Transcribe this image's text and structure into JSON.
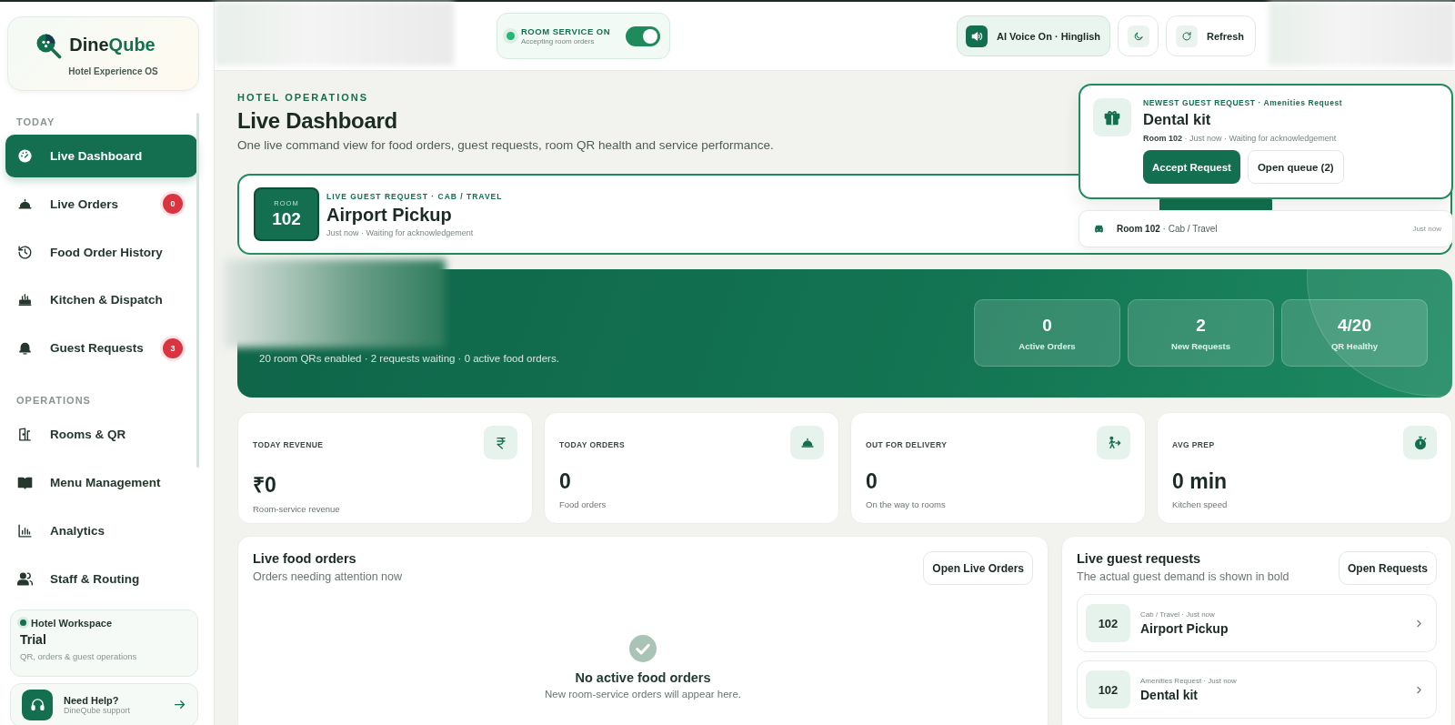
{
  "sidebar": {
    "brand": {
      "name_parts": [
        "Dine",
        "Qube"
      ],
      "tagline": "Hotel Experience OS"
    },
    "sections": [
      {
        "heading": "TODAY",
        "items": [
          {
            "label": "Live Dashboard",
            "selected": true
          },
          {
            "label": "Live Orders",
            "badge": "0",
            "selected": false
          },
          {
            "label": "Food Order History",
            "selected": false
          },
          {
            "label": "Kitchen & Dispatch",
            "selected": false
          },
          {
            "label": "Guest Requests",
            "badge": "3",
            "selected": false
          }
        ]
      },
      {
        "heading": "OPERATIONS",
        "items": [
          {
            "label": "Rooms & QR",
            "selected": false
          },
          {
            "label": "Menu Management",
            "selected": false
          },
          {
            "label": "Analytics",
            "selected": false
          },
          {
            "label": "Staff & Routing",
            "selected": false
          }
        ]
      }
    ],
    "workspace": {
      "label": "Hotel Workspace",
      "plan": "Trial",
      "description": "QR, orders & guest operations"
    },
    "help": {
      "title": "Need Help?",
      "subtitle": "DineQube support"
    }
  },
  "topbar": {
    "room_service": {
      "title": "ROOM SERVICE ON",
      "subtitle": "Accepting room orders",
      "on": true
    },
    "voice": {
      "label": "AI Voice On · Hinglish"
    },
    "refresh": {
      "label": "Refresh"
    }
  },
  "header": {
    "eyebrow": "HOTEL OPERATIONS",
    "title": "Live Dashboard",
    "subtitle": "One live command view for food orders, guest requests, room QR health and service performance."
  },
  "live_request": {
    "room_label": "ROOM",
    "room": "102",
    "eyebrow": "LIVE GUEST REQUEST · CAB / TRAVEL",
    "title": "Airport Pickup",
    "meta": "Just now · Waiting for acknowledgement"
  },
  "toast": {
    "eyebrow": "NEWEST GUEST REQUEST · Amenities Request",
    "title": "Dental kit",
    "meta": "**Room 102** · Just now · Waiting for acknowledgement",
    "buttons": [
      "Accept Request",
      "Open queue (2)"
    ]
  },
  "mini_toast": {
    "text": "**Room 102** · Cab / Travel",
    "time": "Just now"
  },
  "hero": {
    "summary": "20 room QRs enabled · 2 requests waiting · 0 active food orders.",
    "stats": [
      {
        "value": "0",
        "label": "Active Orders"
      },
      {
        "value": "2",
        "label": "New Requests"
      },
      {
        "value": "4/20",
        "label": "QR Healthy"
      }
    ]
  },
  "metrics": [
    {
      "label": "TODAY REVENUE",
      "value": "₹0",
      "sub": "Room-service revenue"
    },
    {
      "label": "TODAY ORDERS",
      "value": "0",
      "sub": "Food orders"
    },
    {
      "label": "OUT FOR DELIVERY",
      "value": "0",
      "sub": "On the way to rooms"
    },
    {
      "label": "AVG PREP",
      "value": "0 min",
      "sub": "Kitchen speed"
    }
  ],
  "food_orders": {
    "title": "Live food orders",
    "subtitle": "Orders needing attention now",
    "button": "Open Live Orders",
    "empty_title": "No active food orders",
    "empty_text": "New room-service orders will appear here."
  },
  "guest_requests": {
    "title": "Live guest requests",
    "subtitle": "The actual guest demand is shown in bold",
    "button": "Open Requests",
    "items": [
      {
        "room": "102",
        "meta": "Cab / Travel · Just now",
        "title": "Airport Pickup"
      },
      {
        "room": "102",
        "meta": "Amenities Request · Just now",
        "title": "Dental kit"
      }
    ]
  }
}
